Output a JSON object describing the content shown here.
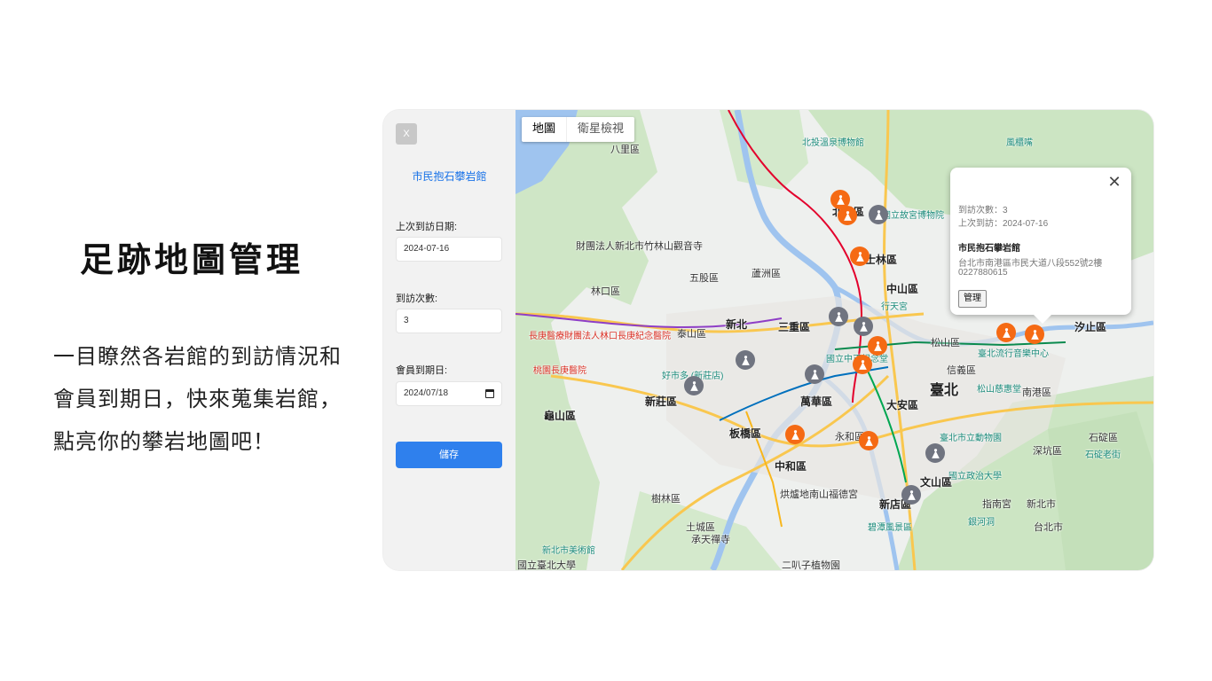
{
  "hero": {
    "title": "足跡地圖管理",
    "description": "一目瞭然各岩館的到訪情況和會員到期日，快來蒐集岩館，點亮你的攀岩地圖吧！"
  },
  "sidebar": {
    "close_label": "X",
    "gym_name": "市民抱石攀岩館",
    "last_visit_label": "上次到訪日期:",
    "last_visit_value": "2024-07-16",
    "visit_count_label": "到訪次數:",
    "visit_count_value": "3",
    "membership_label": "會員到期日:",
    "membership_value": "2024/07/18",
    "save_label": "儲存"
  },
  "map": {
    "type_controls": [
      "地圖",
      "衛星檢視"
    ],
    "selected_type": "地圖",
    "labels": {
      "beitou": "北投區",
      "shilin": "士林區",
      "zhongshan": "中山區",
      "songshan": "松山區",
      "xinyi": "信義區",
      "daan": "大安區",
      "taipei": "臺北",
      "nangang": "南港區",
      "xizhi": "汐止區",
      "wenshan": "文山區",
      "xindian": "新店區",
      "zhonghe": "中和區",
      "yonghe": "永和區",
      "wanhua": "萬華區",
      "banqiao": "板橋區",
      "xinzhuang": "新莊區",
      "sanchong": "三重區",
      "xinbei": "新北",
      "luzhou": "蘆洲區",
      "wugu": "五股區",
      "taishan": "泰山區",
      "linkou": "林口區",
      "bali": "八里區",
      "guishan": "龜山區",
      "shulin": "樹林區",
      "tucheng": "土城區",
      "shiding": "石碇區",
      "shenkeng": "深坑區",
      "beitou_museum": "北投溫泉博物館",
      "palace_museum": "國立故宮博物院",
      "costco": "好市多 (新莊店)",
      "hospital_linkou": "長庚醫療財團法人林口長庚紀念醫院",
      "hospital_taoyuan": "桃園長庚醫院",
      "zoo": "臺北市立動物園",
      "nccu": "國立政治大學",
      "music_center": "臺北流行音樂中心",
      "cks_memorial": "國立中正紀念堂",
      "xingtian": "行天宮",
      "songshan_temple": "松山慈惠堂",
      "yinhe": "銀河洞",
      "bitan": "碧潭風景區",
      "fengqi": "風櫃嘴",
      "art_museum": "新北市美術館",
      "chengtian": "承天禪寺",
      "ntpu": "國立臺北大學",
      "hongludi": "烘爐地南山福德宮",
      "erbazi": "二叭子植物園",
      "zhinan": "指南宮",
      "shiding_old": "石碇老街",
      "xinbeishi": "新北市",
      "taibeishi": "台北市",
      "zhutang": "財團法人新北市竹林山觀音寺"
    }
  },
  "info_window": {
    "visits": "到訪次數：3",
    "last_visit": "上次到訪：2024-07-16",
    "name": "市民抱石攀岩館",
    "address": "台北市南港區市民大道八段552號2樓",
    "phone": "0227880615",
    "manage_label": "管理"
  },
  "colors": {
    "accent": "#2f80ed",
    "marker_visited": "#f56a14",
    "marker_unvisited": "#707480",
    "link": "#1a73e8"
  }
}
